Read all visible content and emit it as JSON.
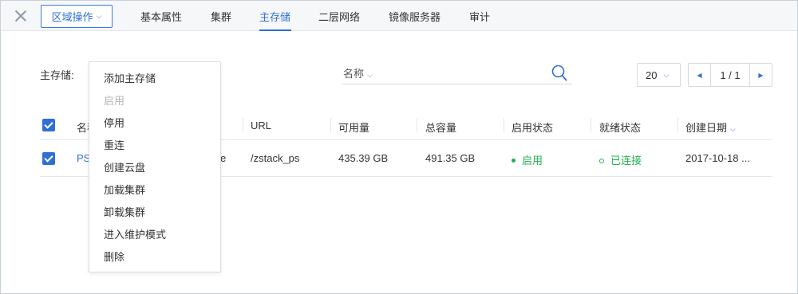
{
  "topbar": {
    "region_button": "区域操作",
    "tabs": [
      "基本属性",
      "集群",
      "主存储",
      "二层网络",
      "镜像服务器",
      "审计"
    ],
    "active_tab": "主存储"
  },
  "toolbar": {
    "label": "主存储:",
    "search_key": "名称",
    "search_value": "",
    "page_size": "20",
    "page_indicator": "1 / 1"
  },
  "table": {
    "columns": [
      "名称",
      "URL",
      "可用量",
      "总容量",
      "启用状态",
      "就绪状态",
      "创建日期"
    ],
    "rows": [
      {
        "name": "PS",
        "type_tail": "e",
        "url": "/zstack_ps",
        "available": "435.39 GB",
        "total": "491.35 GB",
        "state": "启用",
        "status": "已连接",
        "created": "2017-10-18 ..."
      }
    ]
  },
  "menu": {
    "items": [
      {
        "label": "添加主存储",
        "enabled": true
      },
      {
        "label": "启用",
        "enabled": false
      },
      {
        "label": "停用",
        "enabled": true
      },
      {
        "label": "重连",
        "enabled": true
      },
      {
        "label": "创建云盘",
        "enabled": true
      },
      {
        "label": "加载集群",
        "enabled": true
      },
      {
        "label": "卸载集群",
        "enabled": true
      },
      {
        "label": "进入维护模式",
        "enabled": true
      },
      {
        "label": "删除",
        "enabled": true
      }
    ]
  },
  "colors": {
    "accent": "#2f6fd6",
    "success": "#22b14c",
    "disabled_text": "#b4b4b4"
  },
  "icons": [
    "close-icon",
    "chevron-down-icon",
    "search-icon",
    "chevron-left-icon",
    "chevron-right-icon",
    "checkbox-checked-icon"
  ]
}
